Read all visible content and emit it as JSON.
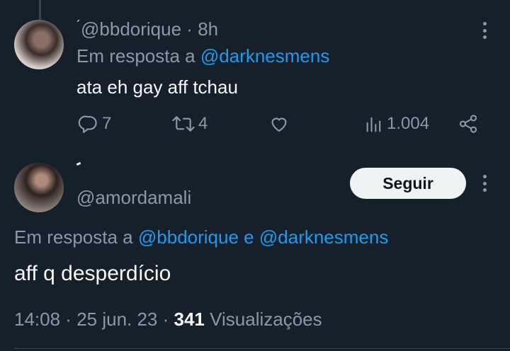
{
  "reply_tweet": {
    "handle": "@bbdorique",
    "time": "8h",
    "separator": "·",
    "reply_prefix": "Em resposta a",
    "reply_to": "@darknesmens",
    "text": "ata eh gay aff tchau",
    "actions": {
      "replies": "7",
      "retweets": "4",
      "views": "1.004"
    }
  },
  "main_tweet": {
    "handle": "@amordamali",
    "follow_label": "Seguir",
    "reply_prefix": "Em resposta a",
    "reply_to_1": "@bbdorique",
    "reply_joiner": "e",
    "reply_to_2": "@darknesmens",
    "text": "aff q desperdício",
    "time": "14:08",
    "date": "25 jun. 23",
    "views_count": "341",
    "views_label": "Visualizações"
  },
  "colors": {
    "background": "#15202b",
    "link": "#1d9bf0",
    "muted": "#8b98a5",
    "text": "#f7f9f9"
  }
}
